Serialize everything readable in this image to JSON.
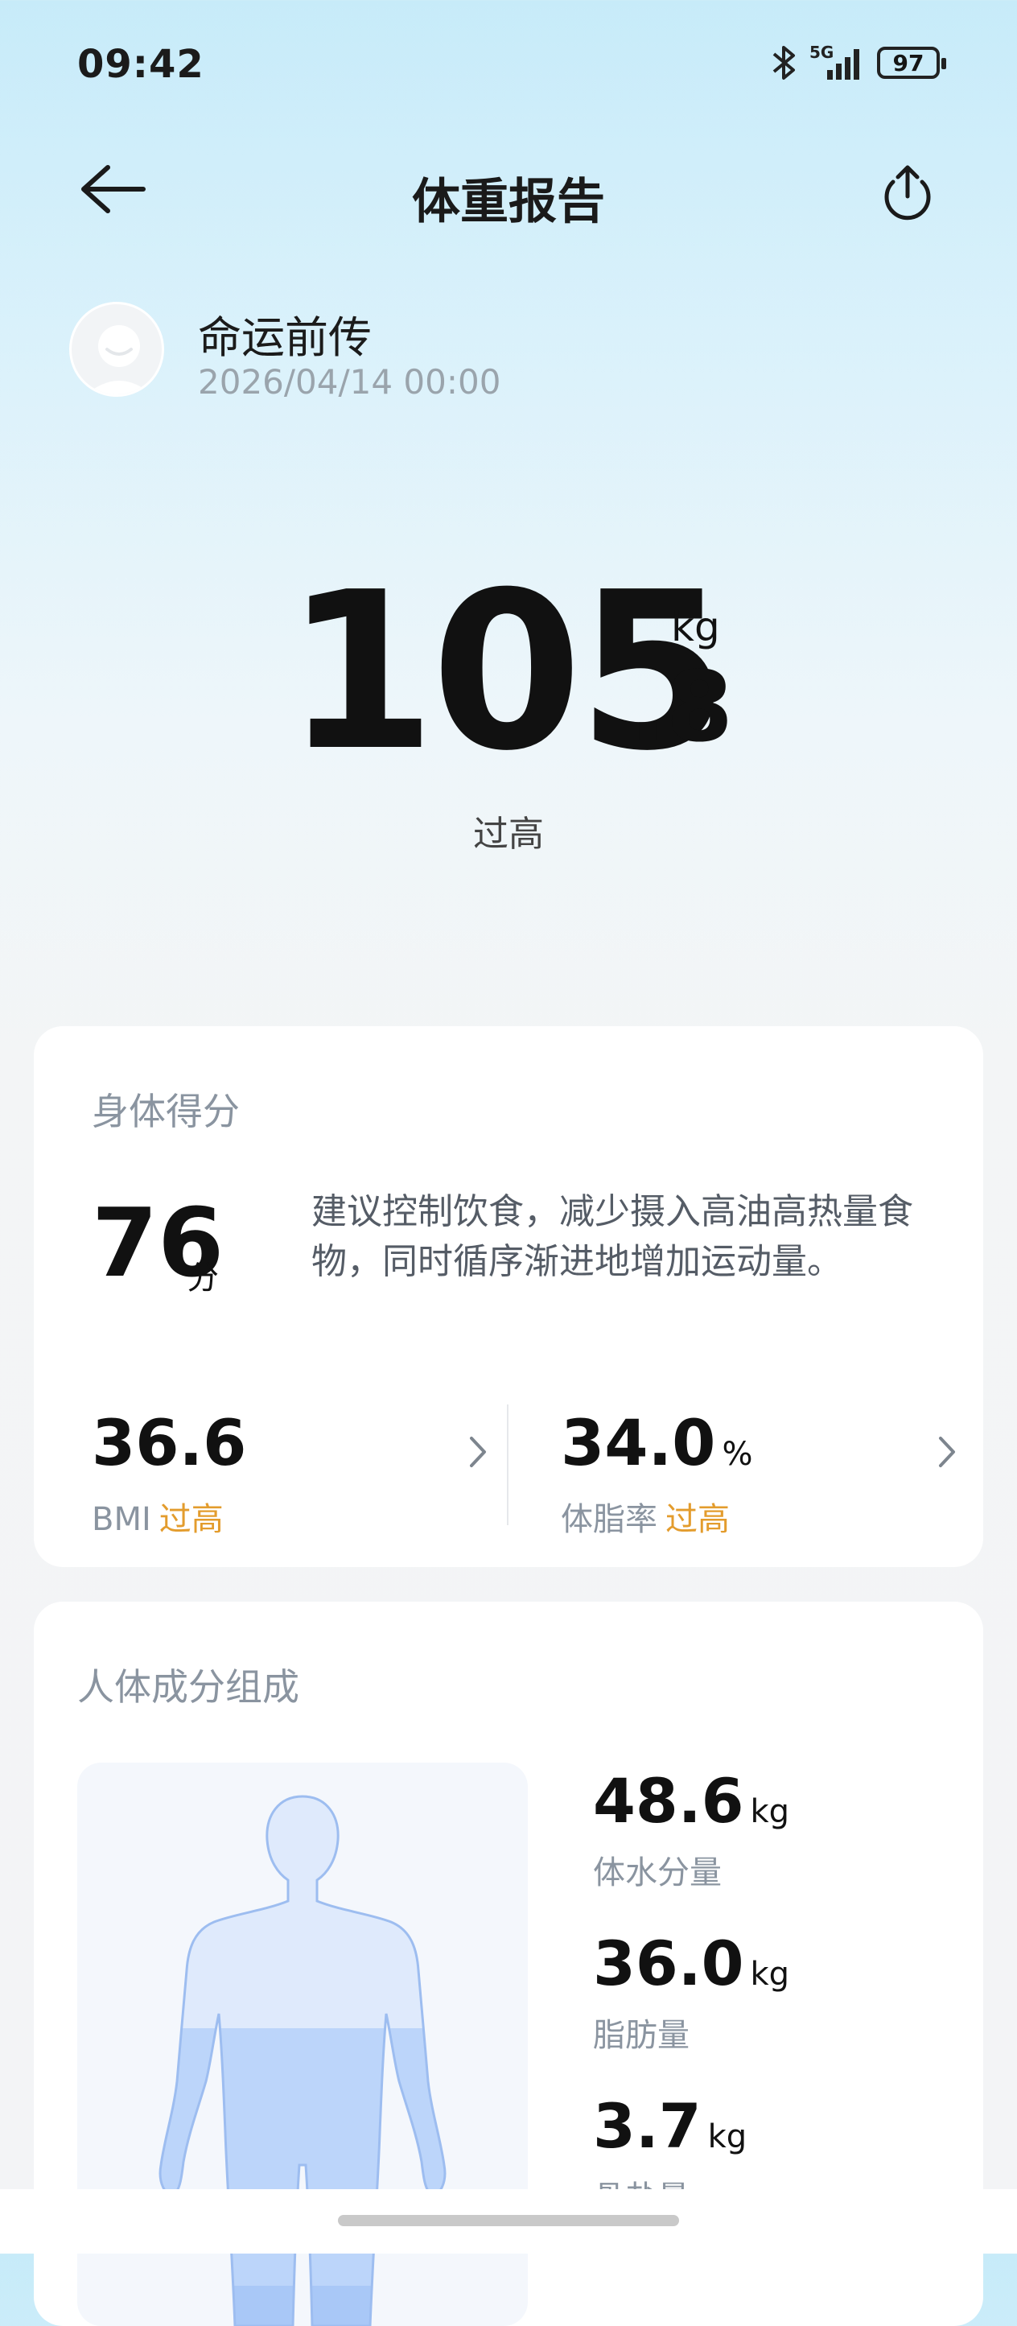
{
  "status_bar": {
    "time": "09:42",
    "network": "5G",
    "battery": "97"
  },
  "header": {
    "title": "体重报告"
  },
  "user": {
    "name": "命运前传",
    "datetime": "2026/04/14 00:00"
  },
  "weight": {
    "integer": "105",
    "decimal": ".8",
    "unit": "kg",
    "status": "过高"
  },
  "score_card": {
    "title": "身体得分",
    "score": "76",
    "score_unit": "分",
    "advice": "建议控制饮食，减少摄入高油高热量食物，同时循序渐进地增加运动量。",
    "bmi": {
      "value": "36.6",
      "label": "BMI",
      "status": "过高"
    },
    "body_fat": {
      "value": "34.0",
      "unit": "%",
      "label": "体脂率",
      "status": "过高"
    },
    "warn_color": "#e39c2d"
  },
  "composition_card": {
    "title": "人体成分组成",
    "items": [
      {
        "value": "48.6",
        "unit": "kg",
        "label": "体水分量"
      },
      {
        "value": "36.0",
        "unit": "kg",
        "label": "脂肪量"
      },
      {
        "value": "3.7",
        "unit": "kg",
        "label": "骨盐量"
      }
    ]
  }
}
